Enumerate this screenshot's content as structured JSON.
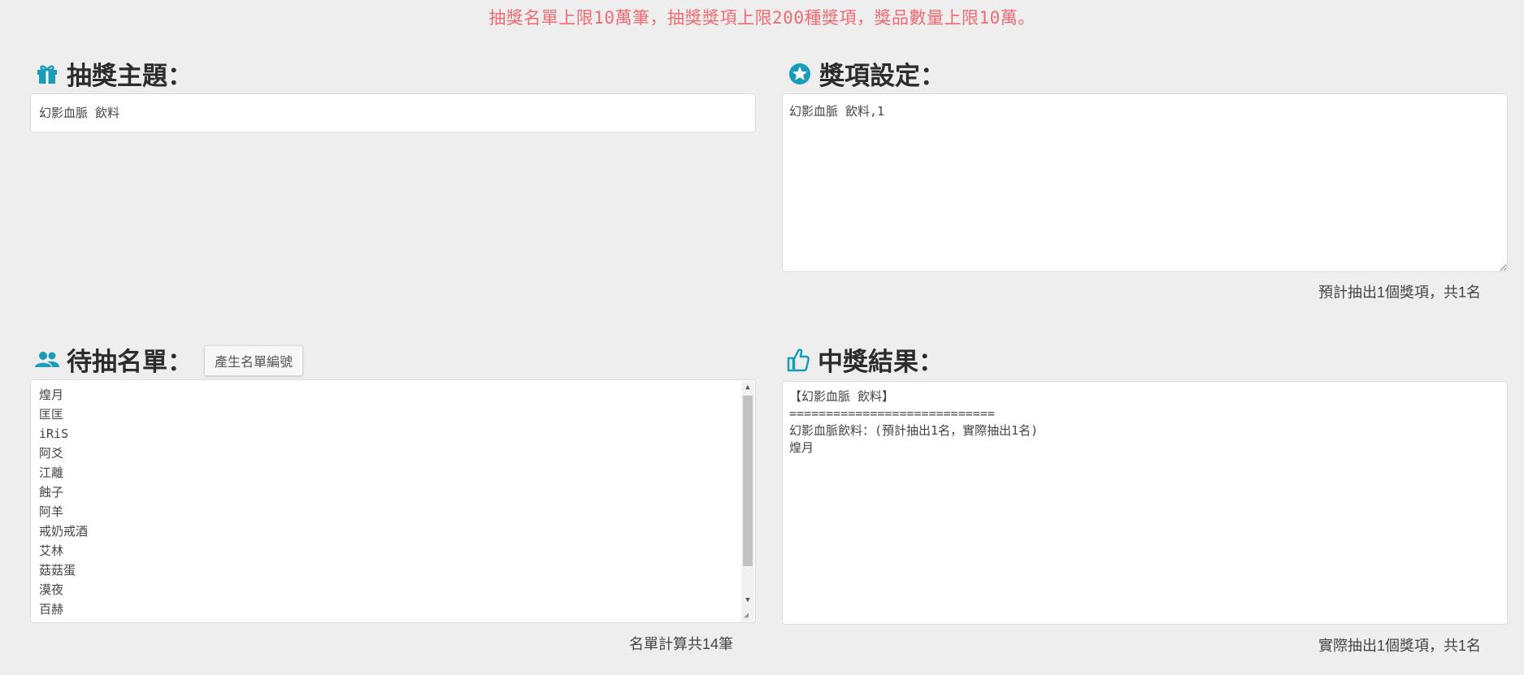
{
  "notice": {
    "part1": "抽獎名單上限",
    "num1": "10",
    "part2": "萬筆，抽獎獎項上限",
    "num2": "200",
    "part3": "種獎項，獎品數量上限",
    "num3": "10",
    "part4": "萬。"
  },
  "theme": {
    "title": "抽獎主題：",
    "icon": "gift-icon",
    "value": "幻影血脈 飲料"
  },
  "prizes": {
    "title": "獎項設定：",
    "icon": "star-circle-icon",
    "value": "幻影血脈 飲料,1",
    "summary": "預計抽出1個獎項，共1名"
  },
  "candidates": {
    "title": "待抽名單：",
    "icon": "people-icon",
    "generate_button": "產生名單編號",
    "items": [
      "煌月",
      "匡匡",
      "iRiS",
      "阿爻",
      "江離",
      "蝕子",
      "阿羊",
      "戒奶戒酒",
      "艾林",
      "菇菇蛋",
      "漠夜",
      "百赫"
    ],
    "summary": "名單計算共14筆"
  },
  "results": {
    "title": "中獎結果：",
    "icon": "thumbs-up-icon",
    "line1": "【幻影血脈 飲料】",
    "line2": "============================",
    "line3": "幻影血脈飲料：(預計抽出1名，實際抽出1名)",
    "line4": "煌月",
    "summary": "實際抽出1個獎項，共1名"
  },
  "colors": {
    "accent": "#1a9bb8",
    "notice": "#ef6b73",
    "background": "#eeeeee"
  }
}
